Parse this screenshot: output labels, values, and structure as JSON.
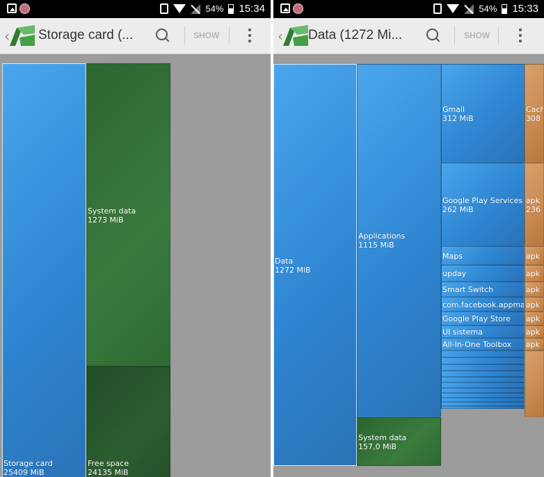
{
  "left": {
    "status": {
      "battery": "54%",
      "time": "15:34"
    },
    "appbar": {
      "title": "Storage card (...",
      "show_label": "SHOW",
      "back": "‹"
    },
    "tiles": {
      "storage_card": {
        "name": "Storage card",
        "size": "25409 MiB"
      },
      "system_data": {
        "name": "System data",
        "size": "1273 MiB"
      },
      "free_space": {
        "name": "Free space",
        "size": "24135 MiB"
      }
    }
  },
  "right": {
    "status": {
      "battery": "54%",
      "time": "15:33"
    },
    "appbar": {
      "title": "Data (1272 Mi...",
      "show_label": "SHOW",
      "back": "‹"
    },
    "tiles": {
      "data": {
        "name": "Data",
        "size": "1272 MiB"
      },
      "applications": {
        "name": "Applications",
        "size": "1115 MiB"
      },
      "system_data": {
        "name": "System data",
        "size": "157,0 MiB"
      },
      "gmail": {
        "name": "Gmail",
        "size": "312 MiB"
      },
      "play_services": {
        "name": "Google Play Services",
        "size": "262 MiB"
      },
      "maps": {
        "name": "Maps"
      },
      "upday": {
        "name": "upday"
      },
      "smart_switch": {
        "name": "Smart Switch"
      },
      "facebook": {
        "name": "com.facebook.appmana"
      },
      "play_store": {
        "name": "Google Play Store"
      },
      "ui_sistema": {
        "name": "UI sistema"
      },
      "toolbox": {
        "name": "All-In-One Toolbox"
      },
      "cache": {
        "name": "Cach",
        "size": "308"
      },
      "apk_main": {
        "name": "apk",
        "size": "236"
      },
      "apk_labels": [
        "apk",
        "apk",
        "apk",
        "apk",
        "apk",
        "apk",
        "apk"
      ]
    }
  },
  "colors": {
    "blue": "#3d97e0",
    "green": "#3a7a3d",
    "dark_green": "#2c5d30",
    "orange": "#c98a50",
    "background": "#9c9c9c"
  }
}
